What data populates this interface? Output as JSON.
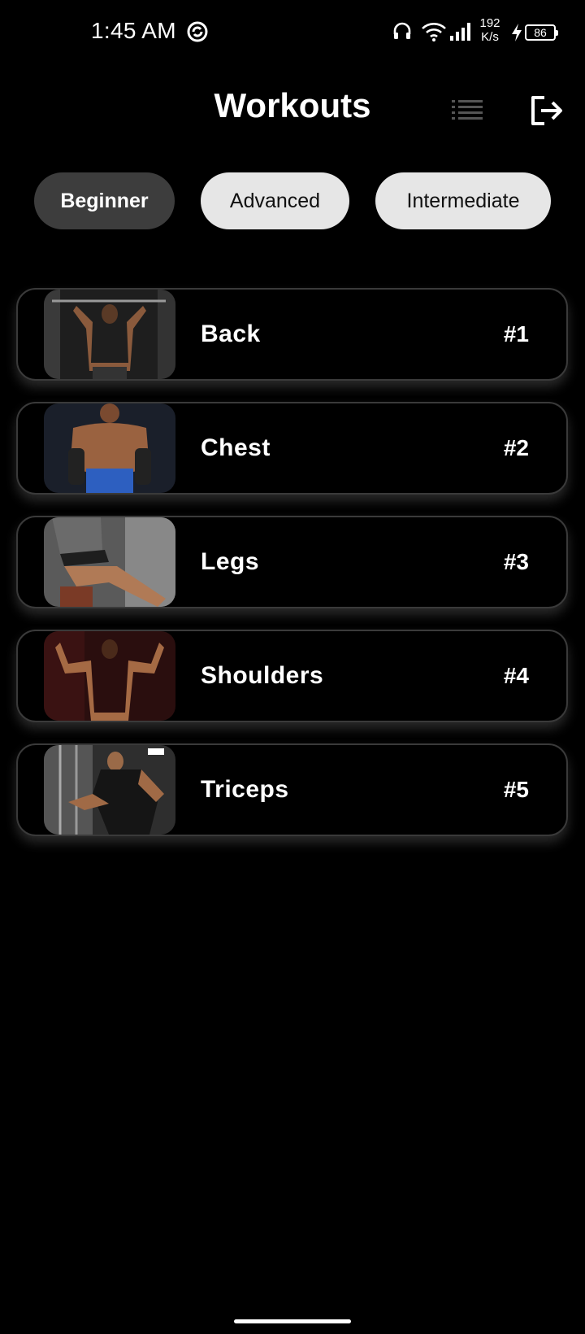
{
  "status_bar": {
    "time": "1:45 AM",
    "net_speed_value": "192",
    "net_speed_unit": "K/s",
    "battery": "86"
  },
  "header": {
    "title": "Workouts"
  },
  "filters": [
    {
      "label": "Beginner",
      "active": true
    },
    {
      "label": "Advanced",
      "active": false
    },
    {
      "label": "Intermediate",
      "active": false
    }
  ],
  "workouts": [
    {
      "name": "Back",
      "number": "#1"
    },
    {
      "name": "Chest",
      "number": "#2"
    },
    {
      "name": "Legs",
      "number": "#3"
    },
    {
      "name": "Shoulders",
      "number": "#4"
    },
    {
      "name": "Triceps",
      "number": "#5"
    }
  ],
  "colors": {
    "background": "#000000",
    "pill_active": "#3d3d3d",
    "pill_inactive": "#e6e6e6",
    "card_border": "#3a3a3a"
  },
  "icons": [
    "sync-icon",
    "headset-icon",
    "wifi-icon",
    "signal-icon",
    "charging-icon",
    "battery-icon",
    "list-icon",
    "logout-icon"
  ]
}
